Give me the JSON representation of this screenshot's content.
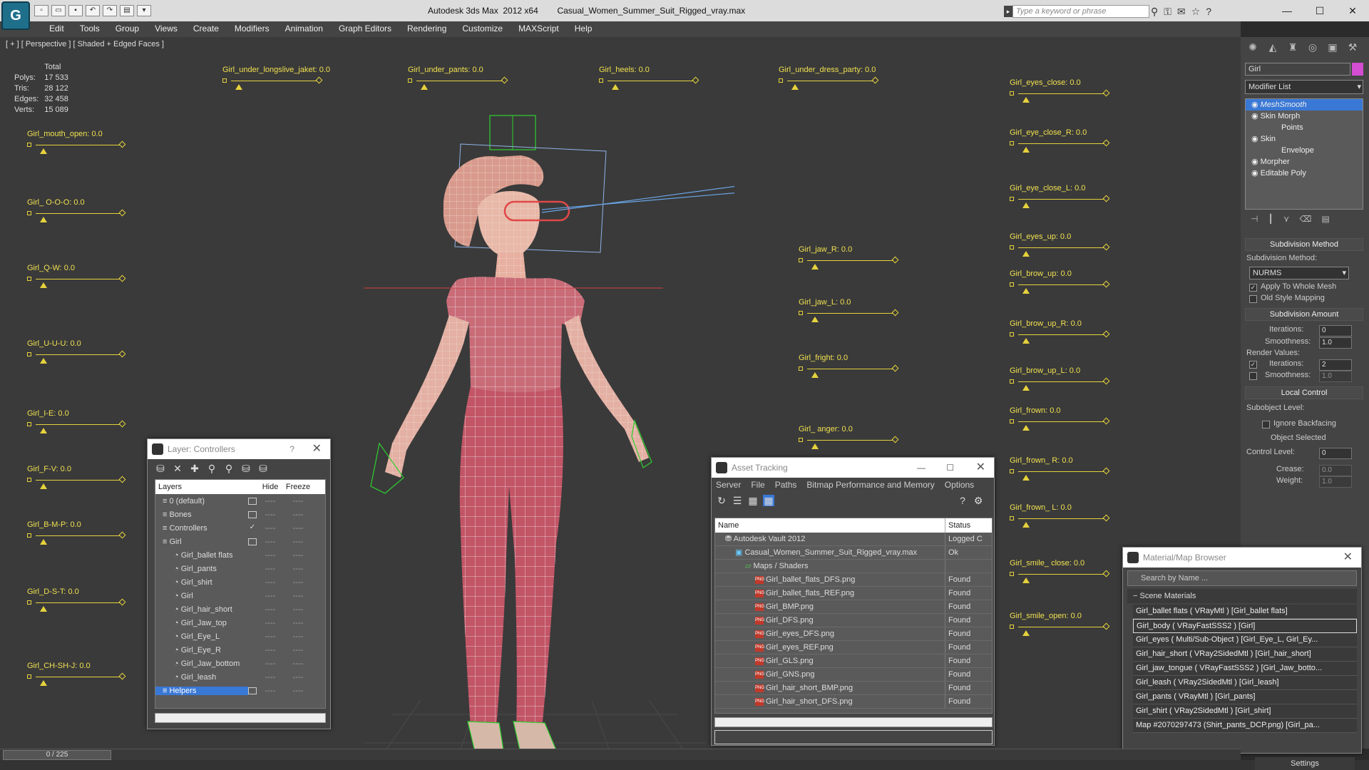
{
  "title": {
    "app": "Autodesk 3ds Max  2012 x64",
    "file": "Casual_Women_Summer_Suit_Rigged_vray.max",
    "search_placeholder": "Type a keyword or phrase",
    "logo": "app-logo"
  },
  "menu": [
    "Edit",
    "Tools",
    "Group",
    "Views",
    "Create",
    "Modifiers",
    "Animation",
    "Graph Editors",
    "Rendering",
    "Customize",
    "MAXScript",
    "Help"
  ],
  "viewport": {
    "label": "[ + ] [ Perspective ] [ Shaded + Edged Faces ]",
    "stats": {
      "header": "Total",
      "rows": [
        {
          "k": "Polys:",
          "v": "17 533"
        },
        {
          "k": "Tris:",
          "v": "28 122"
        },
        {
          "k": "Edges:",
          "v": "32 458"
        },
        {
          "k": "Verts:",
          "v": "15 089"
        }
      ]
    },
    "sliders_left": [
      "Girl_mouth_open: 0.0",
      "Girl_ O-O-O: 0.0",
      "Girl_Q-W: 0.0",
      "Girl_U-U-U: 0.0",
      "Girl_I-E: 0.0",
      "Girl_F-V: 0.0",
      "Girl_B-M-P: 0.0",
      "Girl_D-S-T: 0.0",
      "Girl_CH-SH-J: 0.0"
    ],
    "sliders_top": [
      "Girl_under_longslive_jaket: 0.0",
      "Girl_under_pants: 0.0",
      "Girl_heels: 0.0",
      "Girl_under_dress_party: 0.0"
    ],
    "sliders_mid": [
      "Girl_jaw_R: 0.0",
      "Girl_jaw_L: 0.0",
      "Girl_fright: 0.0",
      "Girl_ anger: 0.0"
    ],
    "sliders_right": [
      "Girl_eyes_close: 0.0",
      "Girl_eye_close_R: 0.0",
      "Girl_eye_close_L: 0.0",
      "Girl_eyes_up: 0.0",
      "Girl_brow_up: 0.0",
      "Girl_brow_up_R: 0.0",
      "Girl_brow_up_L: 0.0",
      "Girl_frown: 0.0",
      "Girl_frown_ R: 0.0",
      "Girl_frown_ L: 0.0",
      "Girl_smile_ close: 0.0",
      "Girl_smile_open: 0.0"
    ]
  },
  "layer_window": {
    "title": "Layer: Controllers",
    "help": "?",
    "columns": [
      "Layers",
      "Hide",
      "Freeze"
    ],
    "rows": [
      {
        "name": "0 (default)",
        "indent": 1,
        "check": "",
        "sel": false
      },
      {
        "name": "Bones",
        "indent": 1,
        "check": "",
        "sel": false
      },
      {
        "name": "Controllers",
        "indent": 1,
        "check": "✓",
        "sel": false
      },
      {
        "name": "Girl",
        "indent": 1,
        "check": "",
        "sel": false
      },
      {
        "name": "Girl_ballet flats",
        "indent": 2,
        "check": "",
        "sel": false
      },
      {
        "name": "Girl_pants",
        "indent": 2,
        "check": "",
        "sel": false
      },
      {
        "name": "Girl_shirt",
        "indent": 2,
        "check": "",
        "sel": false
      },
      {
        "name": "Girl",
        "indent": 2,
        "check": "",
        "sel": false
      },
      {
        "name": "Girl_hair_short",
        "indent": 2,
        "check": "",
        "sel": false
      },
      {
        "name": "Girl_Jaw_top",
        "indent": 2,
        "check": "",
        "sel": false
      },
      {
        "name": "Girl_Eye_L",
        "indent": 2,
        "check": "",
        "sel": false
      },
      {
        "name": "Girl_Eye_R",
        "indent": 2,
        "check": "",
        "sel": false
      },
      {
        "name": "Girl_Jaw_bottom",
        "indent": 2,
        "check": "",
        "sel": false
      },
      {
        "name": "Girl_leash",
        "indent": 2,
        "check": "",
        "sel": false
      },
      {
        "name": "Helpers",
        "indent": 1,
        "check": "",
        "sel": true
      }
    ]
  },
  "asset_window": {
    "title": "Asset Tracking",
    "menu": [
      "Server",
      "File",
      "Paths",
      "Bitmap Performance and Memory",
      "Options"
    ],
    "columns": [
      "Name",
      "Status"
    ],
    "rows": [
      {
        "name": "Autodesk Vault 2012",
        "status": "Logged C",
        "indent": 1
      },
      {
        "name": "Casual_Women_Summer_Suit_Rigged_vray.max",
        "status": "Ok",
        "indent": 2
      },
      {
        "name": "Maps / Shaders",
        "status": "",
        "indent": 3
      },
      {
        "name": "Girl_ballet_flats_DFS.png",
        "status": "Found",
        "indent": 4
      },
      {
        "name": "Girl_ballet_flats_REF.png",
        "status": "Found",
        "indent": 4
      },
      {
        "name": "Girl_BMP.png",
        "status": "Found",
        "indent": 4
      },
      {
        "name": "Girl_DFS.png",
        "status": "Found",
        "indent": 4
      },
      {
        "name": "Girl_eyes_DFS.png",
        "status": "Found",
        "indent": 4
      },
      {
        "name": "Girl_eyes_REF.png",
        "status": "Found",
        "indent": 4
      },
      {
        "name": "Girl_GLS.png",
        "status": "Found",
        "indent": 4
      },
      {
        "name": "Girl_GNS.png",
        "status": "Found",
        "indent": 4
      },
      {
        "name": "Girl_hair_short_BMP.png",
        "status": "Found",
        "indent": 4
      },
      {
        "name": "Girl_hair_short_DFS.png",
        "status": "Found",
        "indent": 4
      }
    ]
  },
  "material_window": {
    "title": "Material/Map Browser",
    "search_placeholder": "Search by Name ...",
    "group": "Scene Materials",
    "rows": [
      "Girl_ballet flats  ( VRayMtl ) [Girl_ballet flats]",
      "Girl_body  ( VRayFastSSS2 ) [Girl]",
      "Girl_eyes  ( Multi/Sub-Object ) [Girl_Eye_L, Girl_Ey...",
      "Girl_hair_short  ( VRay2SidedMtl ) [Girl_hair_short]",
      "Girl_jaw_tongue  ( VRayFastSSS2 ) [Girl_Jaw_botto...",
      "Girl_leash  ( VRay2SidedMtl ) [Girl_leash]",
      "Girl_pants  ( VRayMtl ) [Girl_pants]",
      "Girl_shirt  ( VRay2SidedMtl ) [Girl_shirt]",
      "Map #2070297473 (Shirt_pants_DCP.png) [Girl_pa..."
    ],
    "selected_index": 1
  },
  "command_panel": {
    "object_name": "Girl",
    "object_color": "#d24dd2",
    "modifier_list": "Modifier List",
    "stack": [
      {
        "name": "MeshSmooth",
        "indent": 1,
        "sel": true
      },
      {
        "name": "Skin Morph",
        "indent": 1,
        "sel": false
      },
      {
        "name": "Points",
        "indent": 2,
        "sel": false
      },
      {
        "name": "Skin",
        "indent": 1,
        "sel": false
      },
      {
        "name": "Envelope",
        "indent": 2,
        "sel": false
      },
      {
        "name": "Morpher",
        "indent": 1,
        "sel": false
      },
      {
        "name": "Editable Poly",
        "indent": 1,
        "sel": false
      }
    ],
    "subdiv_method_rollout": "Subdivision Method",
    "subdiv_method_label": "Subdivision Method:",
    "subdiv_method_value": "NURMS",
    "apply_whole_mesh": "Apply To Whole Mesh",
    "old_style": "Old Style Mapping",
    "subdiv_amount_rollout": "Subdivision Amount",
    "iterations_label": "Iterations:",
    "iterations_value": "0",
    "smoothness_label": "Smoothness:",
    "smoothness_value": "1.0",
    "render_values": "Render Values:",
    "r_iterations_label": "Iterations:",
    "r_iterations_value": "2",
    "r_smoothness_label": "Smoothness:",
    "r_smoothness_value": "1.0",
    "local_control_rollout": "Local Control",
    "subobject_level": "Subobject Level:",
    "ignore_backfacing": "Ignore Backfacing",
    "object_selected": "Object Selected",
    "control_level": "Control Level:",
    "control_level_value": "0",
    "crease": "Crease:",
    "crease_value": "0.0",
    "weight": "Weight:",
    "weight_value": "1.0",
    "settings": "Settings"
  },
  "timeline": {
    "frame": "0 / 225"
  }
}
